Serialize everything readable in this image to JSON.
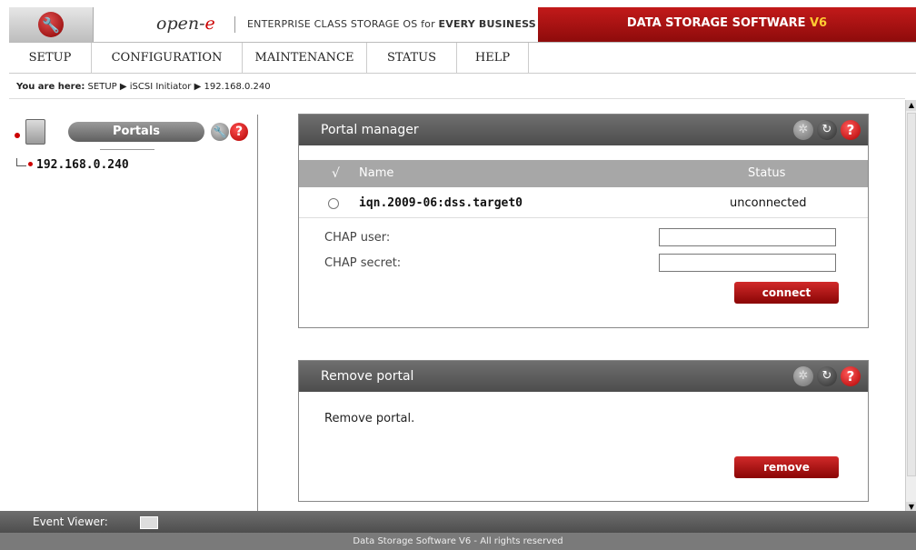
{
  "header": {
    "brand_prefix": "open-",
    "brand_suffix": "e",
    "slogan_normal": "ENTERPRISE CLASS STORAGE OS for ",
    "slogan_bold": "EVERY BUSINESS",
    "product_name": "DATA STORAGE SOFTWARE ",
    "product_version": "V6",
    "logo_icon": "wrench-icon"
  },
  "menu": [
    {
      "label": "SETUP"
    },
    {
      "label": "CONFIGURATION"
    },
    {
      "label": "MAINTENANCE"
    },
    {
      "label": "STATUS"
    },
    {
      "label": "HELP"
    }
  ],
  "breadcrumb": {
    "prefix": "You are here:",
    "items": [
      "SETUP",
      "iSCSI Initiator",
      "192.168.0.240"
    ],
    "separator": "▶"
  },
  "left_panel": {
    "title": "Portals",
    "tree_items": [
      {
        "label": "192.168.0.240"
      }
    ]
  },
  "portal_manager": {
    "title": "Portal manager",
    "columns": {
      "check": "√",
      "name": "Name",
      "status": "Status"
    },
    "rows": [
      {
        "name": "iqn.2009-06:dss.target0",
        "status": "unconnected"
      }
    ],
    "chap_user_label": "CHAP user:",
    "chap_user_value": "",
    "chap_secret_label": "CHAP secret:",
    "chap_secret_value": "",
    "connect_label": "connect"
  },
  "remove_portal": {
    "title": "Remove portal",
    "description": "Remove portal.",
    "remove_label": "remove"
  },
  "event_viewer": {
    "label": "Event Viewer:"
  },
  "footer": {
    "text": "Data Storage Software V6 - All rights reserved"
  },
  "colors": {
    "accent_red": "#a80f0f",
    "header_gray": "#5a5a5a",
    "version_yellow": "#ffcc33"
  }
}
